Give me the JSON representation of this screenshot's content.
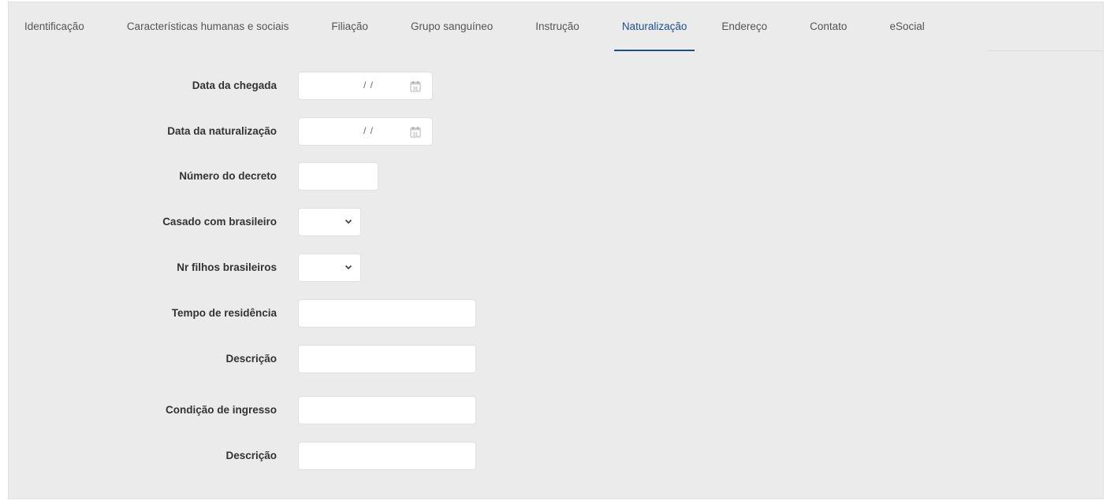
{
  "tabs": [
    {
      "label": "Identificação"
    },
    {
      "label": "Características humanas e sociais"
    },
    {
      "label": "Filiação"
    },
    {
      "label": "Grupo sanguíneo"
    },
    {
      "label": "Instrução"
    },
    {
      "label": "Naturalização",
      "active": true
    },
    {
      "label": "Endereço"
    },
    {
      "label": "Contato"
    },
    {
      "label": "eSocial"
    }
  ],
  "form": {
    "data_chegada": {
      "label": "Data da chegada",
      "value": "/ /"
    },
    "data_naturalizacao": {
      "label": "Data da naturalização",
      "value": "/ /"
    },
    "numero_decreto": {
      "label": "Número do decreto",
      "value": ""
    },
    "casado_brasileiro": {
      "label": "Casado com brasileiro",
      "value": ""
    },
    "nr_filhos": {
      "label": "Nr filhos brasileiros",
      "value": ""
    },
    "tempo_residencia": {
      "label": "Tempo de residência",
      "value": ""
    },
    "descricao1": {
      "label": "Descrição",
      "value": ""
    },
    "condicao_ingresso": {
      "label": "Condição de ingresso",
      "value": ""
    },
    "descricao2": {
      "label": "Descrição",
      "value": ""
    }
  },
  "colors": {
    "accent": "#1f4e8c",
    "panel": "#ebebeb"
  }
}
